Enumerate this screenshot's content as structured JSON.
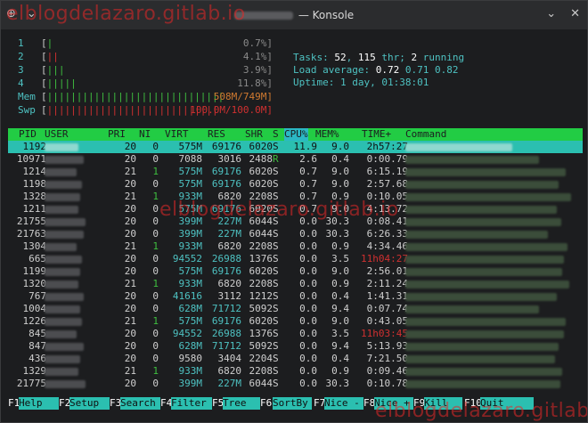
{
  "window": {
    "title": "— Konsole",
    "menu_glyph": "⊕",
    "chevron": "⌄",
    "minimize": "⌄",
    "close": "✕"
  },
  "watermark": "elblogdelazaro.gitlab.io",
  "meters": {
    "cpu": [
      {
        "label": "1",
        "bar": "|",
        "value": "0.7%]"
      },
      {
        "label": "2",
        "bar": "||",
        "value": "4.1%]"
      },
      {
        "label": "3",
        "bar": "|||",
        "value": "3.9%]"
      },
      {
        "label": "4",
        "bar": "|||||",
        "value": "11.8%]"
      }
    ],
    "mem": {
      "label": "Mem",
      "bar": "||||||||||||||||||||||||||||||",
      "value": "508M/749M]"
    },
    "swp": {
      "label": "Swp",
      "bar": "|||||||||||||||||||||||||||||",
      "value": "100.0M/100.0M]"
    }
  },
  "stats": {
    "tasks_prefix": "Tasks: ",
    "tasks": "52",
    "tasks_mid": ", ",
    "thr": "115",
    "tasks_suffix": " thr; ",
    "running": "2",
    "running_suffix": " running",
    "load_prefix": "Load average: ",
    "load1": "0.72",
    "load5": "0.71",
    "load15": "0.82",
    "uptime_prefix": "Uptime: ",
    "uptime": "1 day, 01:38:01"
  },
  "columns": {
    "pid": "PID",
    "user": "USER",
    "pri": "PRI",
    "ni": "NI",
    "virt": "VIRT",
    "res": "RES",
    "shr": "SHR",
    "s": "S",
    "cpu": "CPU%",
    "mem": "MEM%",
    "time": "TIME+",
    "command": "Command"
  },
  "processes": [
    {
      "pid": "1192",
      "pri": "20",
      "ni": "0",
      "virt": "575M",
      "res": "69176",
      "shr": "6020",
      "s": "S",
      "cpu": "11.9",
      "mem": "9.0",
      "time": "2h57:27"
    },
    {
      "pid": "10971",
      "pri": "20",
      "ni": "0",
      "virt": "7088",
      "res": "3016",
      "shr": "2488",
      "s": "R",
      "cpu": "2.6",
      "mem": "0.4",
      "time": "0:00.79"
    },
    {
      "pid": "1214",
      "pri": "21",
      "ni": "1",
      "virt": "575M",
      "res": "69176",
      "shr": "6020",
      "s": "S",
      "cpu": "0.7",
      "mem": "9.0",
      "time": "6:15.19"
    },
    {
      "pid": "1198",
      "pri": "20",
      "ni": "0",
      "virt": "575M",
      "res": "69176",
      "shr": "6020",
      "s": "S",
      "cpu": "0.7",
      "mem": "9.0",
      "time": "2:57.68"
    },
    {
      "pid": "1328",
      "pri": "21",
      "ni": "1",
      "virt": "933M",
      "res": "6820",
      "shr": "2208",
      "s": "S",
      "cpu": "0.7",
      "mem": "0.9",
      "time": "0:10.05"
    },
    {
      "pid": "1211",
      "pri": "20",
      "ni": "0",
      "virt": "575M",
      "res": "69176",
      "shr": "6020",
      "s": "S",
      "cpu": "0.7",
      "mem": "9.0",
      "time": "4:13.72"
    },
    {
      "pid": "21755",
      "pri": "20",
      "ni": "0",
      "virt": "399M",
      "res": "227M",
      "shr": "6044",
      "s": "S",
      "cpu": "0.0",
      "mem": "30.3",
      "time": "0:08.41"
    },
    {
      "pid": "21763",
      "pri": "20",
      "ni": "0",
      "virt": "399M",
      "res": "227M",
      "shr": "6044",
      "s": "S",
      "cpu": "0.0",
      "mem": "30.3",
      "time": "6:26.33"
    },
    {
      "pid": "1304",
      "pri": "21",
      "ni": "1",
      "virt": "933M",
      "res": "6820",
      "shr": "2208",
      "s": "S",
      "cpu": "0.0",
      "mem": "0.9",
      "time": "4:34.46"
    },
    {
      "pid": "665",
      "pri": "20",
      "ni": "0",
      "virt": "94552",
      "res": "26988",
      "shr": "1376",
      "s": "S",
      "cpu": "0.0",
      "mem": "3.5",
      "time": "11h04:27"
    },
    {
      "pid": "1199",
      "pri": "20",
      "ni": "0",
      "virt": "575M",
      "res": "69176",
      "shr": "6020",
      "s": "S",
      "cpu": "0.0",
      "mem": "9.0",
      "time": "2:56.01"
    },
    {
      "pid": "1320",
      "pri": "21",
      "ni": "1",
      "virt": "933M",
      "res": "6820",
      "shr": "2208",
      "s": "S",
      "cpu": "0.0",
      "mem": "0.9",
      "time": "2:11.24"
    },
    {
      "pid": "767",
      "pri": "20",
      "ni": "0",
      "virt": "41616",
      "res": "3112",
      "shr": "1212",
      "s": "S",
      "cpu": "0.0",
      "mem": "0.4",
      "time": "1:41.31"
    },
    {
      "pid": "1004",
      "pri": "20",
      "ni": "0",
      "virt": "628M",
      "res": "71712",
      "shr": "5092",
      "s": "S",
      "cpu": "0.0",
      "mem": "9.4",
      "time": "0:07.74"
    },
    {
      "pid": "1226",
      "pri": "21",
      "ni": "1",
      "virt": "575M",
      "res": "69176",
      "shr": "6020",
      "s": "S",
      "cpu": "0.0",
      "mem": "9.0",
      "time": "0:43.05"
    },
    {
      "pid": "845",
      "pri": "20",
      "ni": "0",
      "virt": "94552",
      "res": "26988",
      "shr": "1376",
      "s": "S",
      "cpu": "0.0",
      "mem": "3.5",
      "time": "11h03:45"
    },
    {
      "pid": "847",
      "pri": "20",
      "ni": "0",
      "virt": "628M",
      "res": "71712",
      "shr": "5092",
      "s": "S",
      "cpu": "0.0",
      "mem": "9.4",
      "time": "5:13.93"
    },
    {
      "pid": "436",
      "pri": "20",
      "ni": "0",
      "virt": "9580",
      "res": "3404",
      "shr": "2204",
      "s": "S",
      "cpu": "0.0",
      "mem": "0.4",
      "time": "7:21.50"
    },
    {
      "pid": "1329",
      "pri": "21",
      "ni": "1",
      "virt": "933M",
      "res": "6820",
      "shr": "2208",
      "s": "S",
      "cpu": "0.0",
      "mem": "0.9",
      "time": "0:09.46"
    },
    {
      "pid": "21775",
      "pri": "20",
      "ni": "0",
      "virt": "399M",
      "res": "227M",
      "shr": "6044",
      "s": "S",
      "cpu": "0.0",
      "mem": "30.3",
      "time": "0:10.78"
    }
  ],
  "fkeys": [
    {
      "key": "F1",
      "label": "Help"
    },
    {
      "key": "F2",
      "label": "Setup"
    },
    {
      "key": "F3",
      "label": "Search"
    },
    {
      "key": "F4",
      "label": "Filter"
    },
    {
      "key": "F5",
      "label": "Tree"
    },
    {
      "key": "F6",
      "label": "SortBy"
    },
    {
      "key": "F7",
      "label": "Nice -"
    },
    {
      "key": "F8",
      "label": "Nice +"
    },
    {
      "key": "F9",
      "label": "Kill"
    },
    {
      "key": "F10",
      "label": "Quit"
    }
  ],
  "colors": {
    "header_bg": "#22cc44",
    "selected_bg": "#2bbfb0",
    "cyan": "#4ec2c2",
    "terminal_bg": "#1c1d1f"
  }
}
